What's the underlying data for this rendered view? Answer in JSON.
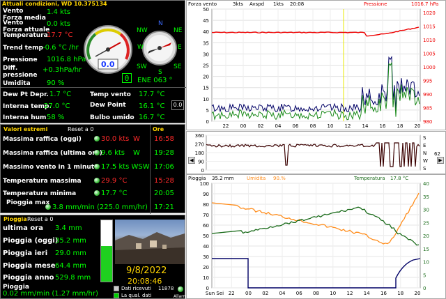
{
  "conditions": {
    "title": "Attuali condizioni, WD 10.375134",
    "rows": [
      {
        "label": "Vento",
        "label2": "Forza media",
        "value": "1.4 kts"
      },
      {
        "label": "Vento",
        "label2": "Forza attuale",
        "value": "0.0 kts"
      },
      {
        "label": "Temperatura",
        "value": "17.7 °C"
      },
      {
        "label": "Trend temp",
        "value": "-0.6 °C /hr"
      },
      {
        "label": "Pressione",
        "value": "1016.8 hPa"
      },
      {
        "label": "Diff.",
        "label2": "pressione",
        "value": "+0.3hPa/hr"
      },
      {
        "label": "Umidita",
        "value": "90 %"
      }
    ],
    "dew_pt_label": "Dew Pt Depr.",
    "dew_pt_value": "1.7 °C",
    "temp_vento_label": "Temp vento",
    "temp_vento_value": "17.7 °C",
    "interna_temp_label": "Interna temp.",
    "interna_temp_value": "27.0 °C",
    "dew_point_label": "Dew Point",
    "dew_point_value": "16.1 °C",
    "interna_hum_label": "Interna hum",
    "interna_hum_value": "58 %",
    "bulbo_label": "Bulbo umido",
    "bulbo_value": "16.7 °C",
    "gauge_speed": "0.0",
    "gauge_digit": "0",
    "gauge_dir": "ENE 063 °",
    "compass": {
      "n": "N",
      "ne": "NE",
      "e": "E",
      "se": "SE",
      "s": "S",
      "sw": "SW",
      "w": "W",
      "nw": "NW"
    },
    "side_value": "0.0"
  },
  "extremes": {
    "title": "Valori estremi",
    "reset": "Reset a 0",
    "ore_title": "Ore",
    "rows": [
      {
        "label": "Massima raffica (oggi)",
        "value": "30.0 kts",
        "unit": "W",
        "time": "16:58",
        "red": true
      },
      {
        "label": "Massima raffica (ultima ora)",
        "value": "9.6 kts",
        "unit": "W",
        "time": "19:28",
        "red": false
      },
      {
        "label": "Massimo vento in 1 minuto",
        "value": "17.5 kts WSW",
        "unit": "",
        "time": "17:06",
        "red": false
      },
      {
        "label": "Temperatura massima",
        "value": "29.9 °C",
        "unit": "",
        "time": "15:28",
        "red": true
      },
      {
        "label": "Temperatura minima",
        "value": "17.7 °C",
        "unit": "",
        "time": "20:05",
        "red": false
      },
      {
        "label": "Pioggia max",
        "value": "3.8 mm/min (225.0 mm/hr)",
        "unit": "",
        "time": "17:21",
        "red": false
      }
    ]
  },
  "rain": {
    "title": "Pioggia",
    "reset": "Reset a 0",
    "rows": [
      {
        "label": "ultima ora",
        "value": "3.4 mm"
      },
      {
        "label": "Pioggia (oggi)",
        "value": "35.2 mm"
      },
      {
        "label": "Pioggia ieri",
        "value": "29.0 mm"
      },
      {
        "label": "Pioggia mese",
        "value": "64.4 mm"
      },
      {
        "label": "Pioggia anno",
        "value": "529.8 mm"
      }
    ],
    "rate_label": "Pioggia",
    "rate_value": "0.02 mm/min (1.27 mm/hr)",
    "date": "9/8/2022",
    "time": "20:08:46",
    "rx_label": "Dati ricevuti",
    "rx_count": "11878",
    "quality_label": "La qual. dati",
    "allarmi": "Allarmi"
  },
  "chart1": {
    "header_left": "Forza vento",
    "header_v1": "3kts",
    "header_avg": "Avspd",
    "header_v2": "1kts",
    "header_time": "20:08",
    "header_right": "Pressione",
    "header_press": "1016.7 hPa",
    "left_ticks": [
      "50",
      "45",
      "40",
      "35",
      "30",
      "25",
      "20",
      "15",
      "10",
      "5",
      "0"
    ],
    "right_ticks": [
      "1020",
      "1015",
      "1010",
      "1005",
      "1000",
      "995",
      "990",
      "985",
      "980"
    ],
    "x_ticks": [
      "22",
      "00",
      "02",
      "04",
      "06",
      "08",
      "10",
      "12",
      "14",
      "16",
      "18",
      "20"
    ]
  },
  "chart2": {
    "left_ticks": [
      "360",
      "270",
      "180",
      "90",
      "0"
    ],
    "side_labels": [
      "S",
      "E",
      "N",
      "W",
      "S"
    ],
    "side_value": "62",
    "x_ticks": [
      "22",
      "00",
      "02",
      "04",
      "06",
      "08",
      "10",
      "12",
      "14",
      "16",
      "18",
      "20"
    ]
  },
  "chart3": {
    "header_left": "Pioggia",
    "header_rain": "35.2 mm",
    "header_hum": "Umidita",
    "header_hum_val": "90.%",
    "header_temp": "Temperatura",
    "header_temp_val": "17.8 °C",
    "left_ticks": [
      "100",
      "90",
      "80",
      "70",
      "60",
      "50",
      "40",
      "30",
      "20",
      "10",
      "0"
    ],
    "right_ticks": [
      "40",
      "35",
      "30",
      "25",
      "20",
      "15",
      "10",
      "5",
      "0"
    ],
    "x_ticks": [
      "Sun Sei",
      "22",
      "00",
      "02",
      "04",
      "06",
      "08",
      "10",
      "12",
      "14",
      "16",
      "18",
      "20"
    ]
  },
  "colors": {
    "accent": "#ffd400",
    "value": "#00ff00",
    "alert": "#ff2a2a",
    "pressure": "#ee0000",
    "humidity": "#ff8c1a",
    "temperature": "#1a6b1a",
    "wind": "#000066"
  }
}
